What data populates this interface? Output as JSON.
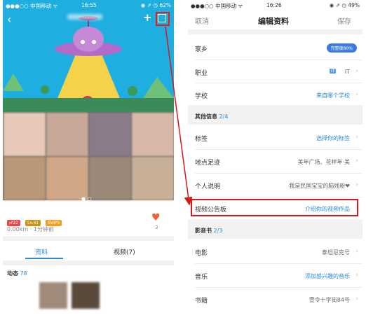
{
  "left": {
    "status": {
      "carrier": "●●●○○ 中国移动 ᯤ",
      "time": "16:55",
      "battery": "◉ ⇗ ◷ 62%"
    },
    "badges": [
      {
        "text": "♂22",
        "color": "#e84848"
      },
      {
        "text": "Lv.41",
        "color": "#c8941c"
      },
      {
        "text": "SVIP5",
        "color": "#f0a020"
      }
    ],
    "distance": "0.00km · 1分钟前",
    "likes": "3",
    "tabs": [
      {
        "label": "资料"
      },
      {
        "label": "视频(7)"
      }
    ],
    "dynamic": {
      "label": "动态",
      "count": "78"
    }
  },
  "right": {
    "status": {
      "carrier": "●●●○○ 中国移动 ᯤ",
      "time": "16:26",
      "battery": "◉ ⇗ ◷ 49%"
    },
    "nav": {
      "cancel": "取消",
      "title": "编辑资料",
      "save": "保存"
    },
    "rows_top": [
      {
        "label": "家乡",
        "value": "完整度80%"
      },
      {
        "label": "职业",
        "tag": "IT",
        "value": "IT"
      },
      {
        "label": "学校",
        "value": "来自哪个学校"
      }
    ],
    "section_other": {
      "label": "其他信息",
      "count": "2/4"
    },
    "rows_other": [
      {
        "label": "标签",
        "value": "选择你的标签"
      },
      {
        "label": "地点足迹",
        "value": "美年广场、花样年·美"
      },
      {
        "label": "个人说明",
        "value": "我是民国宝宝的脑残粉❤"
      },
      {
        "label": "视频公告板",
        "value": "介绍你的视频作品"
      }
    ],
    "section_media": {
      "label": "影音书",
      "count": "2/3"
    },
    "rows_media": [
      {
        "label": "电影",
        "value": "泰坦尼克号"
      },
      {
        "label": "音乐",
        "value": "添加感兴趣的音乐"
      },
      {
        "label": "书籍",
        "value": "壹令十字街84号"
      }
    ]
  },
  "colors": {
    "accent": "#2a8ad8",
    "highlight": "#d81818",
    "hero": "#1faee0"
  }
}
